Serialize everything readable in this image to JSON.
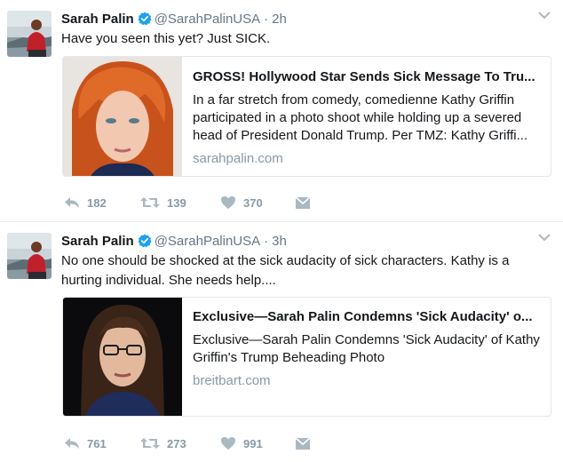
{
  "colors": {
    "verified": "#1da1f2",
    "muted": "#8899a6",
    "text": "#14171a",
    "border": "#e1e8ed"
  },
  "tweets": [
    {
      "author": {
        "name": "Sarah Palin",
        "handle": "@SarahPalinUSA",
        "verified": true
      },
      "time": "2h",
      "separator": "·",
      "text": "Have you seen this yet? Just SICK.",
      "card": {
        "title": "GROSS! Hollywood Star Sends Sick Message To Tru...",
        "description": "In a far stretch from comedy, comedienne Kathy Griffin participated in a photo shoot while holding up a severed head of President Donald Trump. Per TMZ: Kathy Griffi...",
        "domain": "sarahpalin.com",
        "image_icon": "woman-red-hair-photo"
      },
      "actions": {
        "replies": "182",
        "retweets": "139",
        "likes": "370"
      }
    },
    {
      "author": {
        "name": "Sarah Palin",
        "handle": "@SarahPalinUSA",
        "verified": true
      },
      "time": "3h",
      "separator": "·",
      "text": "No one should be shocked at the sick audacity of sick characters. Kathy is a hurting individual. She needs help....",
      "card": {
        "title": "Exclusive—Sarah Palin Condemns 'Sick Audacity' o...",
        "description": "Exclusive—Sarah Palin Condemns 'Sick Audacity' of Kathy Griffin's Trump Beheading Photo",
        "domain": "breitbart.com",
        "image_icon": "woman-glasses-photo"
      },
      "actions": {
        "replies": "761",
        "retweets": "273",
        "likes": "991"
      }
    }
  ]
}
